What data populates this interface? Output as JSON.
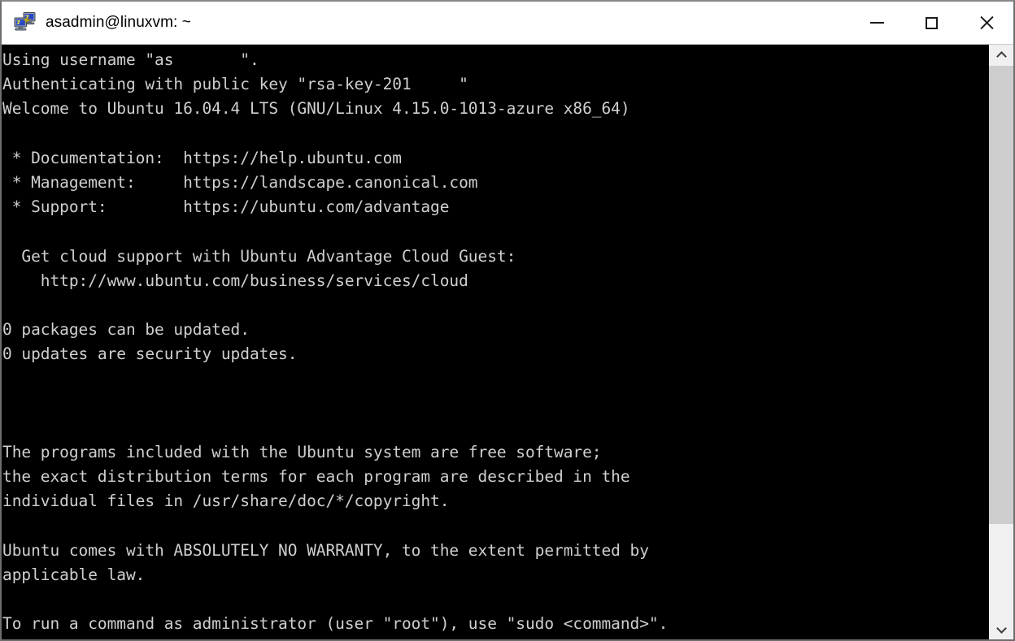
{
  "window": {
    "title": "asadmin@linuxvm: ~",
    "icon": "putty-icon",
    "controls": {
      "minimize_label": "Minimize",
      "maximize_label": "Maximize",
      "close_label": "Close"
    }
  },
  "terminal": {
    "background_color": "#000000",
    "text_color": "#cfcfcf",
    "lines": [
      "Using username \"as███████\".",
      "Authenticating with public key \"rsa-key-201█████\"",
      "Welcome to Ubuntu 16.04.4 LTS (GNU/Linux 4.15.0-1013-azure x86_64)",
      "",
      " * Documentation:  https://help.ubuntu.com",
      " * Management:     https://landscape.canonical.com",
      " * Support:        https://ubuntu.com/advantage",
      "",
      "  Get cloud support with Ubuntu Advantage Cloud Guest:",
      "    http://www.ubuntu.com/business/services/cloud",
      "",
      "0 packages can be updated.",
      "0 updates are security updates.",
      "",
      "",
      "",
      "The programs included with the Ubuntu system are free software;",
      "the exact distribution terms for each program are described in the",
      "individual files in /usr/share/doc/*/copyright.",
      "",
      "Ubuntu comes with ABSOLUTELY NO WARRANTY, to the extent permitted by",
      "applicable law.",
      "",
      "To run a command as administrator (user \"root\"), use \"sudo <command>\"."
    ]
  },
  "scrollbar": {
    "up_arrow": "chevron-up-icon",
    "down_arrow": "chevron-down-icon",
    "thumb_position_percent": 0,
    "thumb_size_percent": 83
  }
}
